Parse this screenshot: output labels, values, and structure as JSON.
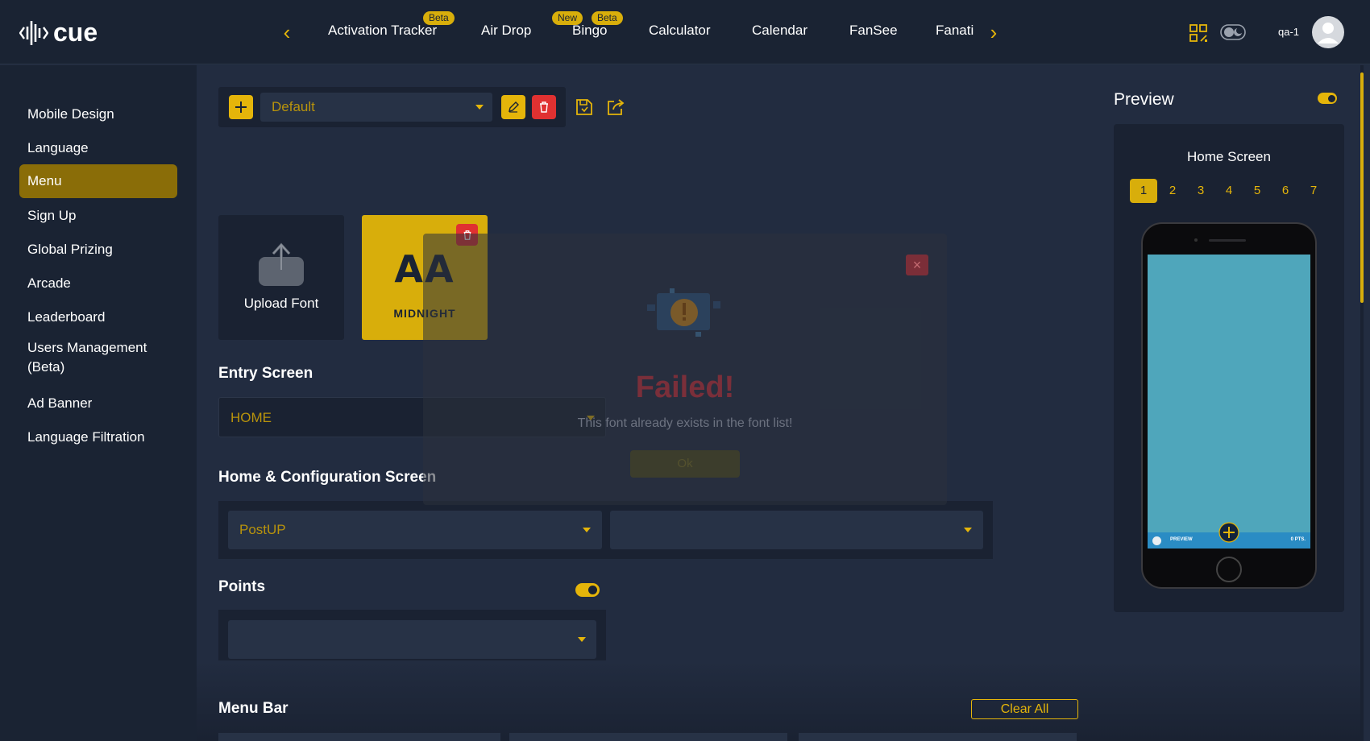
{
  "header": {
    "logo_text": "cue",
    "tabs": [
      {
        "label": "Activation Tracker",
        "badges": [
          "Beta"
        ]
      },
      {
        "label": "Air Drop",
        "badges": []
      },
      {
        "label": "Bingo",
        "badges": [
          "New",
          "Beta"
        ]
      },
      {
        "label": "Calculator",
        "badges": []
      },
      {
        "label": "Calendar",
        "badges": []
      },
      {
        "label": "FanSee",
        "badges": []
      },
      {
        "label": "Fanati",
        "badges": []
      }
    ],
    "user_name": "qa-1"
  },
  "sidebar": {
    "items": [
      {
        "label": "Mobile Design"
      },
      {
        "label": "Language"
      },
      {
        "label": "Menu",
        "active": true
      },
      {
        "label": "Sign Up"
      },
      {
        "label": "Global Prizing"
      },
      {
        "label": "Arcade"
      },
      {
        "label": "Leaderboard"
      },
      {
        "label": "Users Management (Beta)"
      },
      {
        "label": "Ad Banner"
      },
      {
        "label": "Language Filtration"
      }
    ]
  },
  "toolbar": {
    "theme_select": "Default"
  },
  "fonts": {
    "upload_label": "Upload Font",
    "card_glyph": "AA",
    "card_name": "MIDNIGHT"
  },
  "entry_screen": {
    "title": "Entry Screen",
    "value": "HOME"
  },
  "home_config": {
    "title": "Home & Configuration Screen",
    "value_1": "PostUP",
    "value_2": ""
  },
  "points": {
    "title": "Points",
    "value": "",
    "enabled": true
  },
  "menu_bar": {
    "title": "Menu Bar",
    "clear_label": "Clear All"
  },
  "preview": {
    "title": "Preview",
    "screen_title": "Home Screen",
    "pages": [
      "1",
      "2",
      "3",
      "4",
      "5",
      "6",
      "7"
    ],
    "active_page": "1",
    "bar_left": "PREVIEW",
    "bar_right": "0 PTS."
  },
  "modal": {
    "title": "Failed!",
    "message": "This font already exists in the font list!",
    "ok_label": "Ok"
  },
  "colors": {
    "accent": "#e5b50a",
    "danger": "#e03131",
    "background": "#222c40",
    "sidebar": "#1a2333"
  }
}
